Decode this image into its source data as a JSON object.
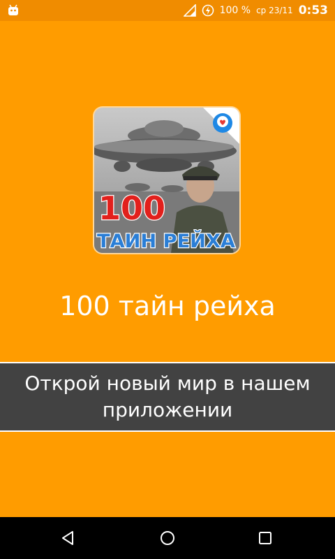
{
  "status_bar": {
    "battery_percent": "100 %",
    "date": "ср 23/11",
    "time": "0:53",
    "icons": [
      "android-debug-icon",
      "signal-icon",
      "battery-charging-icon"
    ]
  },
  "app_icon": {
    "number_text": "100",
    "subtitle_text": "ТАИН РЕЙХА"
  },
  "splash": {
    "title": "100 тайн рейха",
    "banner_text": "Открой новый мир в нашем приложении"
  },
  "nav_bar": {
    "icons": [
      "back-icon",
      "home-icon",
      "recent-apps-icon"
    ]
  },
  "colors": {
    "background": "#ff9c00",
    "status_bar": "#f08c00",
    "banner": "#424242",
    "text": "#ffffff"
  }
}
